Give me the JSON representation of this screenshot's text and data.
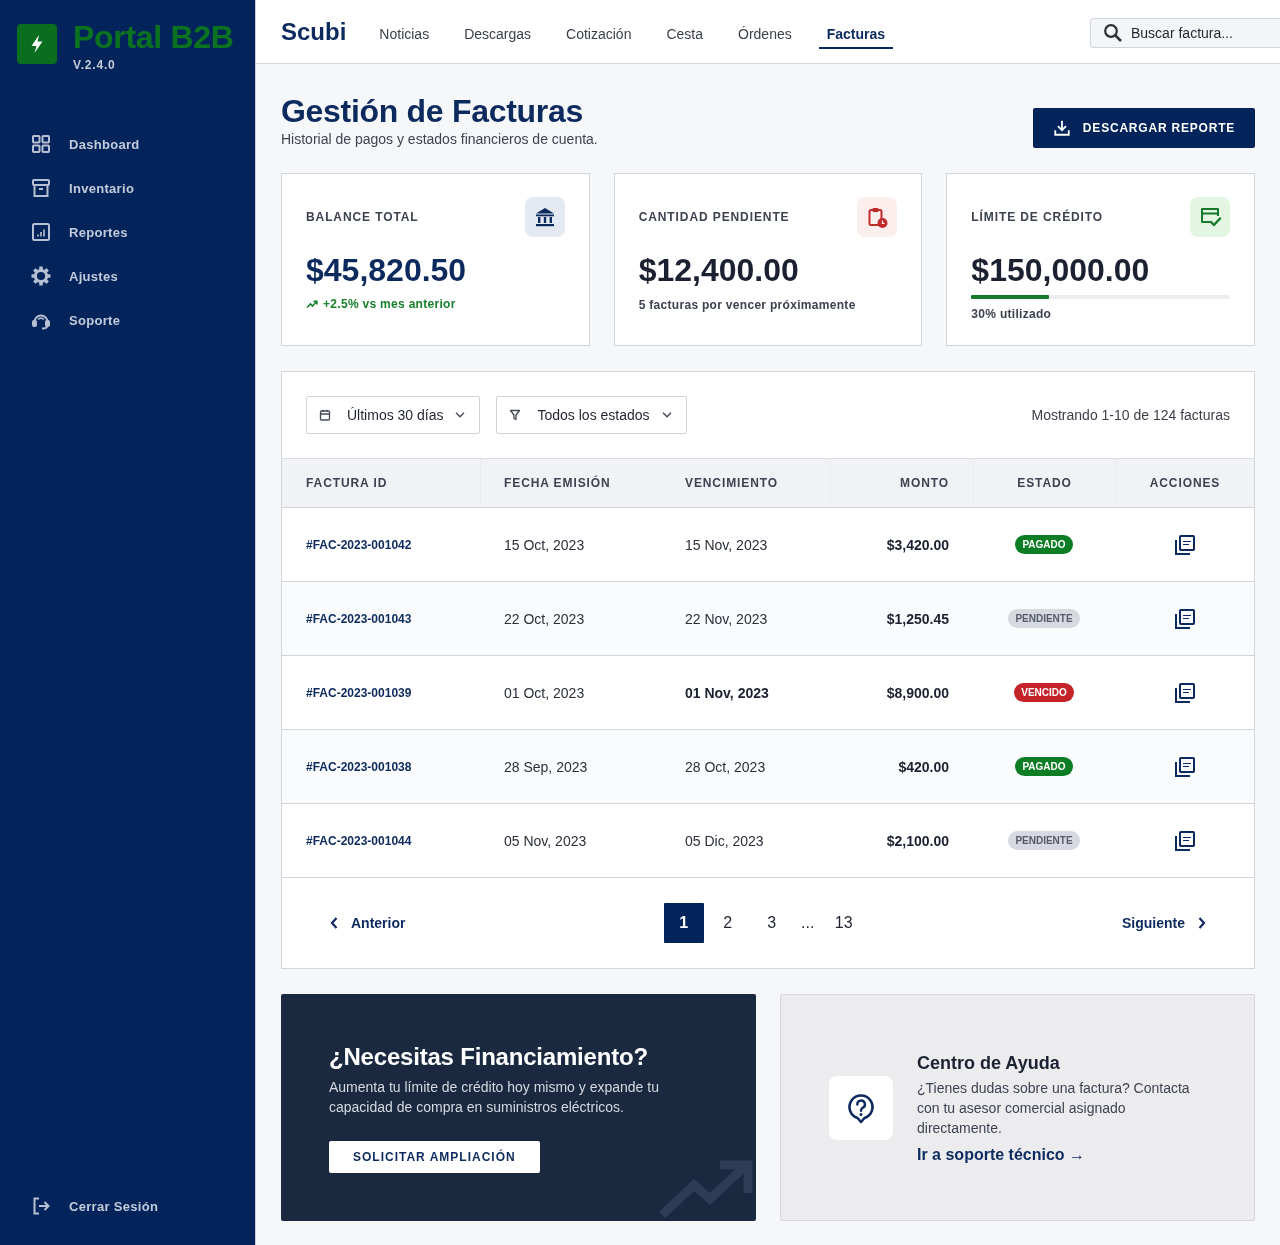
{
  "sidebar": {
    "logo": {
      "title": "Portal B2B",
      "version": "V.2.4.0"
    },
    "items": [
      "Dashboard",
      "Inventario",
      "Reportes",
      "Ajustes",
      "Soporte"
    ],
    "logout": "Cerrar Sesión"
  },
  "header": {
    "brand": "Scubi",
    "tabs": [
      {
        "label": "Noticias",
        "selected": false
      },
      {
        "label": "Descargas",
        "selected": false
      },
      {
        "label": "Cotización",
        "selected": false
      },
      {
        "label": "Cesta",
        "selected": false
      },
      {
        "label": "Órdenes",
        "selected": false
      },
      {
        "label": "Facturas",
        "selected": true
      }
    ],
    "search": {
      "placeholder": "Buscar factura..."
    }
  },
  "page": {
    "title": "Gestión de Facturas",
    "subtitle": "Historial de pagos y estados financieros de cuenta.",
    "download_button": "DESCARGAR REPORTE"
  },
  "stats": [
    {
      "kind": "balance",
      "label": "BALANCE TOTAL",
      "value": "$45,820.50",
      "note": "+2.5% vs mes anterior"
    },
    {
      "kind": "pending",
      "label": "CANTIDAD PENDIENTE",
      "value": "$12,400.00",
      "note": "5 facturas por vencer próximamente"
    },
    {
      "kind": "credit",
      "label": "LÍMITE DE CRÉDITO",
      "value": "$150,000.00",
      "level": 0.3,
      "note": "30% utilizado"
    }
  ],
  "invoices": {
    "filters": [
      "Últimos 30 días",
      "Todos los estados"
    ],
    "summary": "Mostrando 1-10 de 124 facturas",
    "columns": [
      "FACTURA ID",
      "FECHA EMISIÓN",
      "VENCIMIENTO",
      "MONTO",
      "ESTADO",
      "ACCIONES"
    ],
    "rows": [
      {
        "id": "#FAC-2023-001042",
        "issued": "15 Oct, 2023",
        "due": "15 Nov, 2023",
        "amount": "$3,420.00",
        "status": {
          "kind": "paid",
          "label": "PAGADO"
        }
      },
      {
        "id": "#FAC-2023-001043",
        "issued": "22 Oct, 2023",
        "due": "22 Nov, 2023",
        "amount": "$1,250.45",
        "status": {
          "kind": "pending",
          "label": "PENDIENTE"
        }
      },
      {
        "id": "#FAC-2023-001039",
        "issued": "01 Oct, 2023",
        "due": "01 Nov, 2023",
        "amount": "$8,900.00",
        "status": {
          "kind": "overdue",
          "label": "VENCIDO"
        }
      },
      {
        "id": "#FAC-2023-001038",
        "issued": "28 Sep, 2023",
        "due": "28 Oct, 2023",
        "amount": "$420.00",
        "status": {
          "kind": "paid",
          "label": "PAGADO"
        }
      },
      {
        "id": "#FAC-2023-001044",
        "issued": "05 Nov, 2023",
        "due": "05 Dic, 2023",
        "amount": "$2,100.00",
        "status": {
          "kind": "pending",
          "label": "PENDIENTE"
        }
      }
    ],
    "pagination": {
      "previous": "Anterior",
      "pages": [
        {
          "kind": "page",
          "label": "1",
          "selected": true
        },
        {
          "kind": "page",
          "label": "2",
          "selected": false
        },
        {
          "kind": "page",
          "label": "3",
          "selected": false
        },
        {
          "kind": "gap",
          "label": "..."
        },
        {
          "kind": "page",
          "label": "13",
          "selected": false
        }
      ],
      "next": "Siguiente"
    }
  },
  "financing": {
    "title": "¿Necesitas Financiamiento?",
    "text": "Aumenta tu límite de crédito hoy mismo y expande tu capacidad de compra en suministros eléctricos.",
    "button": "SOLICITAR AMPLIACIÓN"
  },
  "help": {
    "title": "Centro de Ayuda",
    "text": "¿Tienes dudas sobre una factura? Contacta con tu asesor comercial asignado directamente.",
    "link": "Ir a soporte técnico →"
  }
}
